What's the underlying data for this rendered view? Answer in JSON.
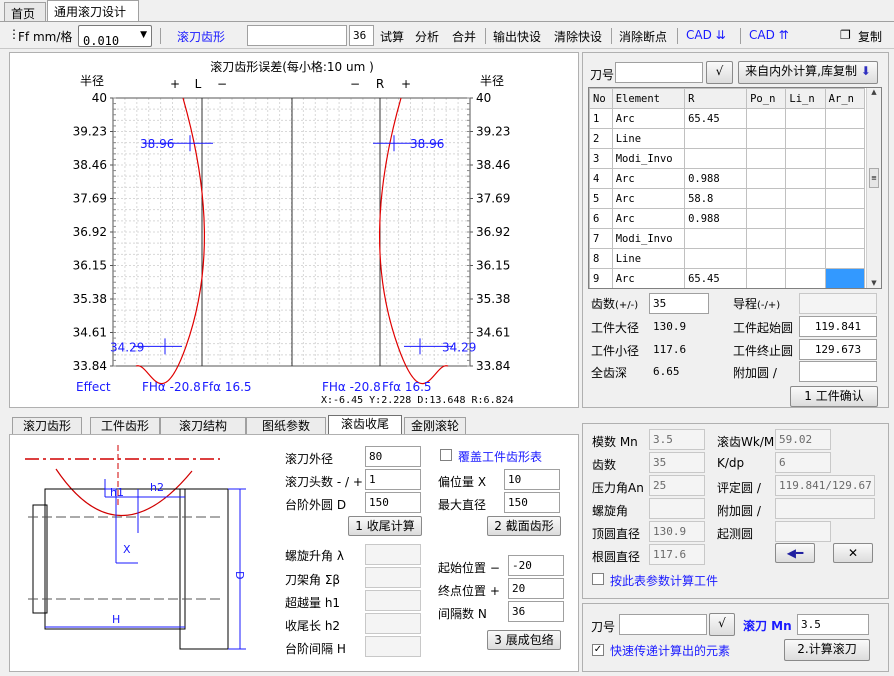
{
  "top_tabs": [
    "首页",
    "通用滚刀设计"
  ],
  "toolbar": {
    "ff_label": "Ff mm/格",
    "ff_value": "0.010",
    "hob_profile": "滚刀齿形",
    "teeth_box": "36",
    "trial": "试算",
    "analyze": "分析",
    "merge": "合并",
    "export_shortcut": "输出快设",
    "clear_shortcut": "清除快设",
    "clear_breakpoint": "消除断点",
    "cad_down": "CAD ⇊",
    "cad_up": "CAD ⇈",
    "copy": "复制"
  },
  "chart_data": {
    "type": "line",
    "title": "滚刀齿形误差(每小格:10 um )",
    "ylabel_left": "半径",
    "ylabel_right": "半径",
    "ylim": [
      33.84,
      40
    ],
    "yticks": [
      "40",
      "39.23",
      "38.46",
      "37.69",
      "36.92",
      "36.15",
      "35.38",
      "34.61",
      "33.84"
    ],
    "left_markers": {
      "plus": "+",
      "L": "L",
      "minus": "−"
    },
    "right_markers": {
      "minus": "−",
      "R": "R",
      "plus": "+"
    },
    "mark_top": "38.96",
    "mark_bottom": "34.29",
    "effect": "Effect",
    "left_fha": "FHα -20.8",
    "left_ffa": "Ffα    16.5",
    "right_fha": "FHα -20.8",
    "right_ffa": "Ffα    16.5",
    "coords": "X:-6.45  Y:2.228  D:13.648  R:6.824"
  },
  "hob_no": {
    "label": "刀号",
    "confirm": "√",
    "calc_btn": "来自内外计算,库复制"
  },
  "elem_table": {
    "headers": [
      "No",
      "Element",
      "R",
      "Po_n",
      "Li_n",
      "Ar_n"
    ],
    "rows": [
      [
        "1",
        "Arc",
        "65.45",
        "",
        "",
        ""
      ],
      [
        "2",
        "Line",
        "",
        "",
        "",
        ""
      ],
      [
        "3",
        "Modi_Invo",
        "",
        "",
        "",
        ""
      ],
      [
        "4",
        "Arc",
        "0.988",
        "",
        "",
        ""
      ],
      [
        "5",
        "Arc",
        "58.8",
        "",
        "",
        ""
      ],
      [
        "6",
        "Arc",
        "0.988",
        "",
        "",
        ""
      ],
      [
        "7",
        "Modi_Invo",
        "",
        "",
        "",
        ""
      ],
      [
        "8",
        "Line",
        "",
        "",
        "",
        ""
      ],
      [
        "9",
        "Arc",
        "65.45",
        "",
        "",
        ""
      ]
    ]
  },
  "work": {
    "teeth_label": "齿数",
    "teeth_sub": "(+/-)",
    "teeth": "35",
    "lead_label": "导程",
    "lead_sub": "(-/+)",
    "lead": "",
    "od_label": "工件大径",
    "od": "130.9",
    "start_label": "工件起始圆",
    "start": "119.841",
    "id_label": "工件小径",
    "id": "117.6",
    "end_label": "工件终止圆",
    "end": "129.673",
    "depth_label": "全齿深",
    "depth": "6.65",
    "add_label": "附加圆",
    "add_sep": "/",
    "add": "",
    "confirm_btn": "1 工件确认"
  },
  "bottom_tabs": [
    "滚刀齿形",
    "工件齿形",
    "滚刀结构",
    "图纸参数",
    "滚齿收尾",
    "金刚滚轮"
  ],
  "tail": {
    "hob_od_label": "滚刀外径",
    "hob_od": "80",
    "starts_label": "滚刀头数 - / +",
    "starts": "1",
    "step_label": "台阶外圆 D",
    "step": "150",
    "tail_calc": "1 收尾计算",
    "cover_label": "覆盖工件齿形表",
    "offset_label": "偏位量  X",
    "offset": "10",
    "maxd_label": "最大直径",
    "maxd": "150",
    "section_btn": "2 截面齿形",
    "helix_label": "螺旋升角 λ",
    "rake_label": "刀架角  Σβ",
    "over_label": "超越量  h1",
    "tail_len_label": "收尾长  h2",
    "gap_label": "台阶间隔 H",
    "startpos_label": "起始位置 −",
    "startpos": "-20",
    "endpos_label": "终点位置 +",
    "endpos": "20",
    "interval_label": "间隔数  N",
    "interval": "36",
    "envelope_btn": "3 展成包络",
    "dims": {
      "h1": "h1",
      "h2": "h2",
      "X": "X",
      "H": "H",
      "D": "D"
    }
  },
  "params": {
    "module_label": "模数 Mn",
    "module": "3.5",
    "wk_label": "滚齿Wk/M",
    "wk": "59.02",
    "teeth_label": "齿数",
    "teeth": "35",
    "kdp_label": "K/dp",
    "kdp": "6",
    "pa_label": "压力角An",
    "pa": "25",
    "eval_label": "评定圆 /",
    "eval": "119.841/129.673",
    "helix_label": "螺旋角",
    "helix": "",
    "addc_label": "附加圆 /",
    "addc": "",
    "tip_label": "顶圆直径",
    "tip": "130.9",
    "start_label": "起测圆",
    "startc": "",
    "root_label": "根圆直径",
    "root": "117.6",
    "arrow_btn": "◀━",
    "close_btn": "✕",
    "use_table_label": "按此表参数计算工件"
  },
  "hob_bottom": {
    "no_label": "刀号",
    "confirm": "√",
    "hob_label": "滚刀 Mn",
    "hob_mn": "3.5",
    "fast_label": "快速传递计算出的元素",
    "calc_btn": "2.计算滚刀"
  }
}
